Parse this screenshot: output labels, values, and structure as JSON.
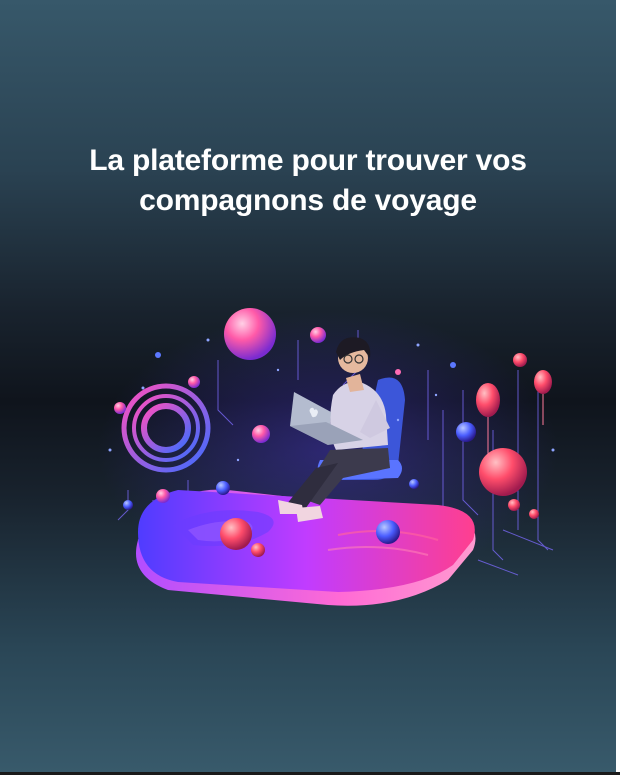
{
  "hero": {
    "title_line_1": "La plateforme pour trouver vos",
    "title_line_2": "compagnons de voyage"
  },
  "illustration": {
    "subject": "person-with-laptop-on-chair",
    "icons": [
      "laptop-icon",
      "apple-logo-icon",
      "ring-icon",
      "balloon-icon"
    ]
  },
  "colors": {
    "background_top": "#37586a",
    "background_middle": "#0f141c",
    "background_bottom": "#385a6b",
    "title": "#ffffff",
    "neon_pink": "#ff4fa3",
    "neon_blue": "#3f6cff",
    "neon_purple": "#a05cff"
  }
}
